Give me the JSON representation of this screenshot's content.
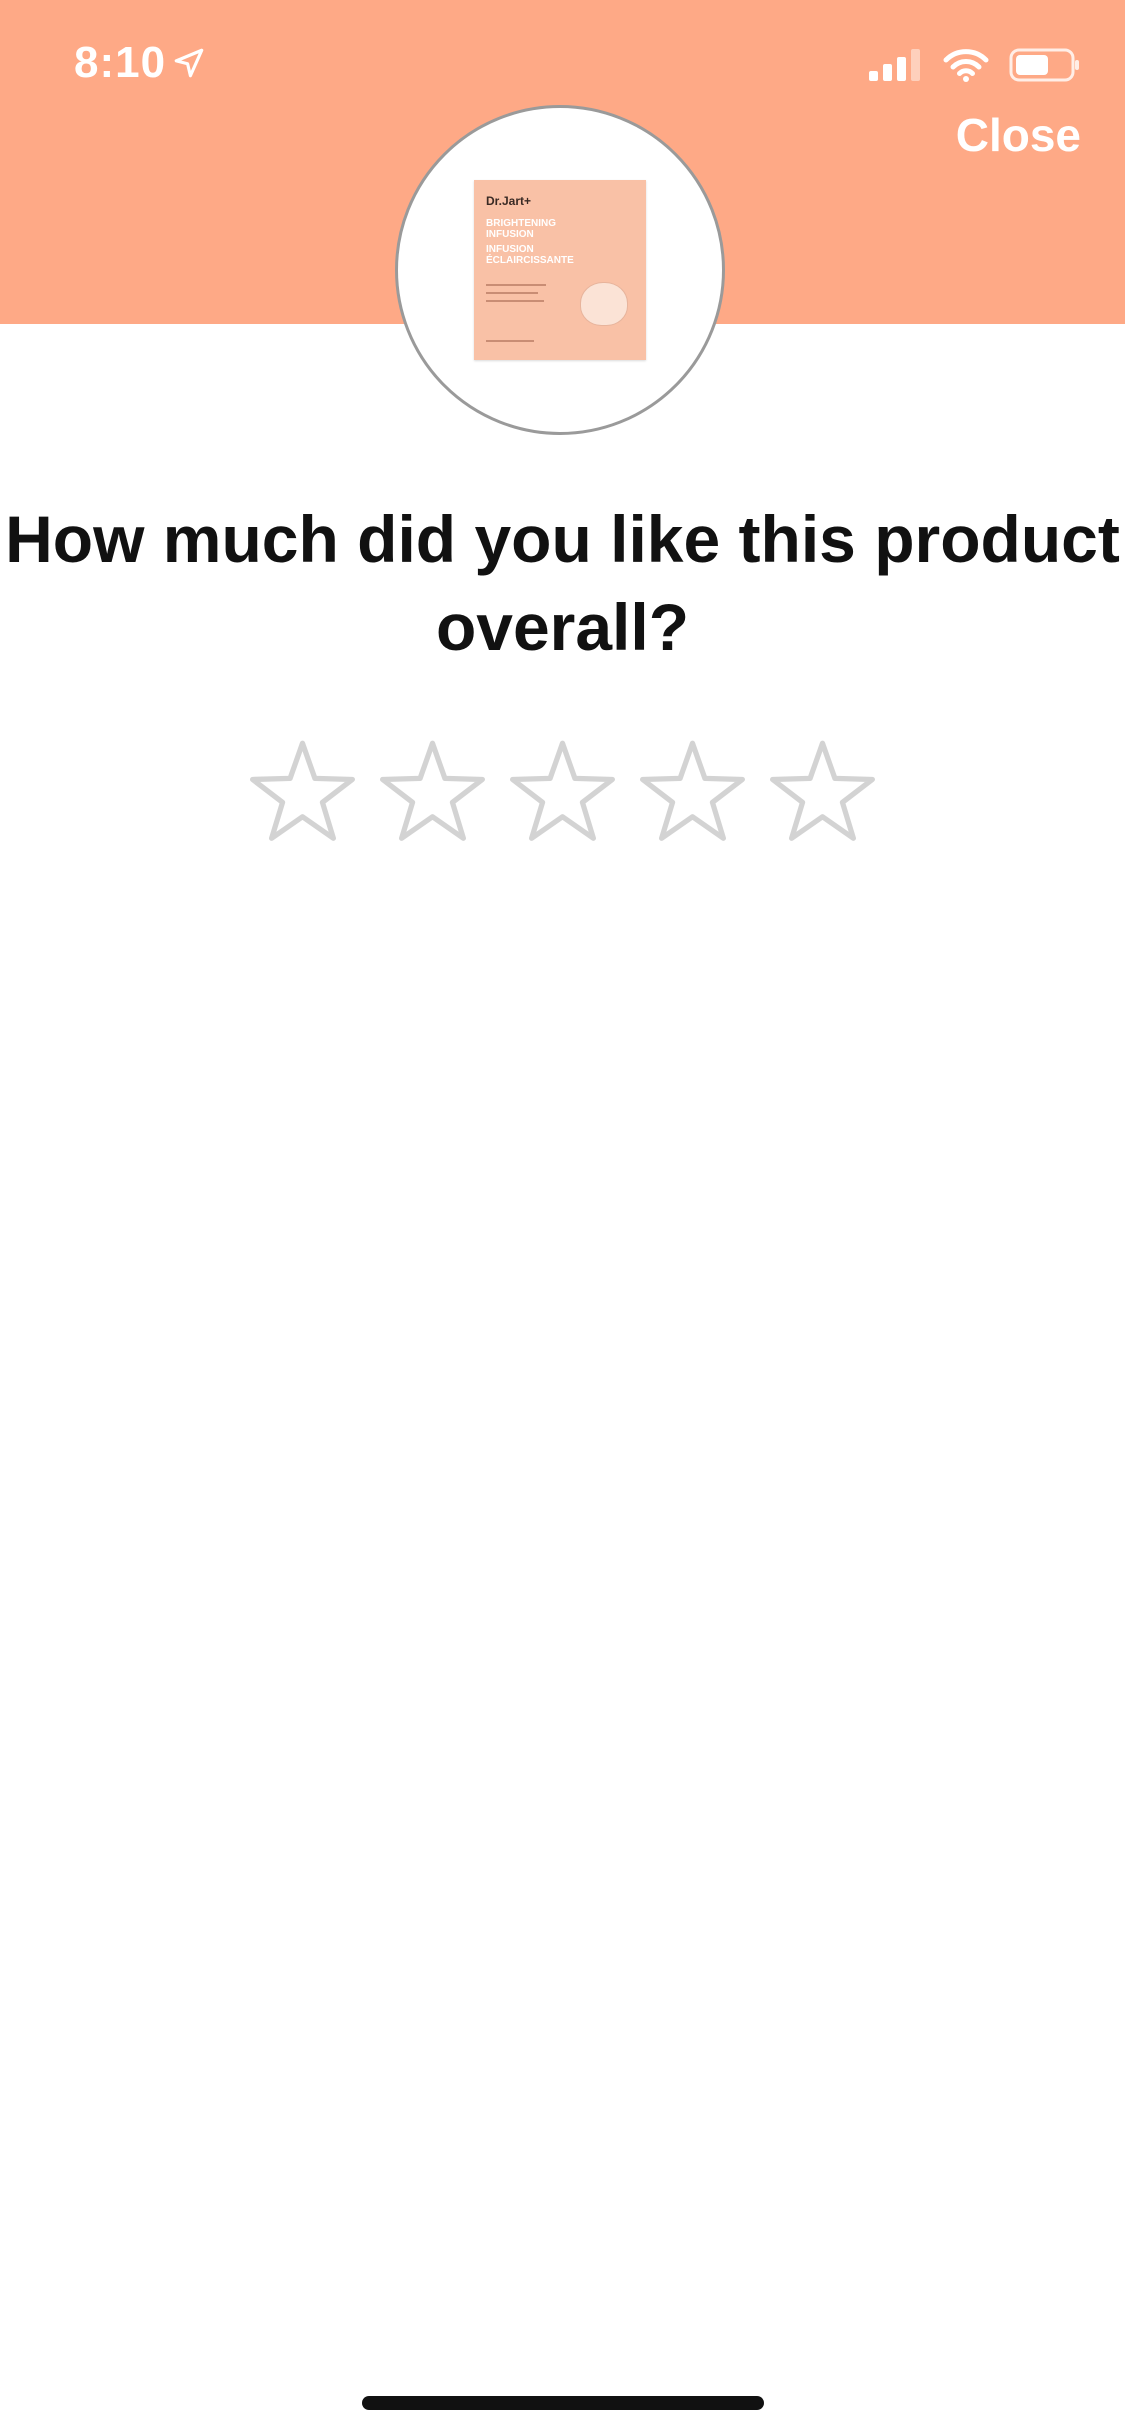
{
  "status_bar": {
    "time": "8:10",
    "location_icon": "location-arrow-icon",
    "signal_icon": "cellular-signal-icon",
    "wifi_icon": "wifi-icon",
    "battery_icon": "battery-icon"
  },
  "header": {
    "close_label": "Close",
    "background_color": "#FEA986"
  },
  "product": {
    "brand": "Dr.Jart+",
    "line1": "BRIGHTENING",
    "line2": "INFUSION",
    "line3": "INFUSION",
    "line4": "ÉCLAIRCISSANTE"
  },
  "rating": {
    "question": "How much did you like this product overall?",
    "max_stars": 5,
    "selected_stars": 0,
    "star_outline_color": "#D3D3D3"
  }
}
